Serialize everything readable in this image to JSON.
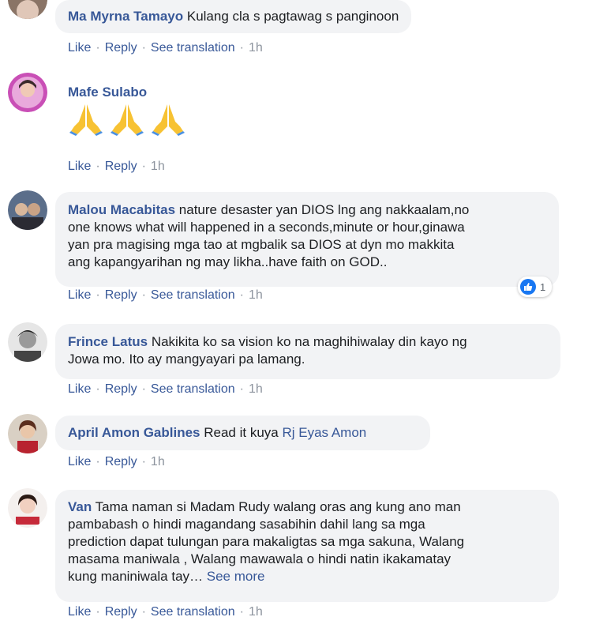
{
  "comments": [
    {
      "author": "Ma Myrna Tamayo",
      "text": "Kulang cla s pagtawag s panginoon",
      "actions": [
        "Like",
        "Reply",
        "See translation"
      ],
      "time": "1h"
    },
    {
      "author": "Mafe Sulabo",
      "emojis": [
        "folded-hands",
        "folded-hands",
        "folded-hands"
      ],
      "actions": [
        "Like",
        "Reply"
      ],
      "time": "1h"
    },
    {
      "author": "Malou Macabitas",
      "text_lines": [
        "nature desaster yan DIOS lng ang nakkaalam,no",
        "one knows what will happened in a seconds,minute or hour,ginawa",
        "yan pra magising mga tao at mgbalik sa DIOS at dyn mo makkita",
        "ang kapangyarihan ng may likha..have faith on GOD.."
      ],
      "reaction_count": "1",
      "actions": [
        "Like",
        "Reply",
        "See translation"
      ],
      "time": "1h"
    },
    {
      "author": "Frince Latus",
      "text_lines": [
        "Nakikita ko sa vision ko na maghihiwalay din kayo ng",
        "Jowa mo. Ito ay mangyayari pa lamang."
      ],
      "actions": [
        "Like",
        "Reply",
        "See translation"
      ],
      "time": "1h"
    },
    {
      "author": "April Amon Gablines",
      "text": "Read it kuya",
      "mention": "Rj Eyas Amon",
      "actions": [
        "Like",
        "Reply"
      ],
      "time": "1h"
    },
    {
      "author": "Van",
      "text_lines": [
        "Tama naman si Madam Rudy walang oras ang kung ano man",
        "pambabash o hindi magandang sasabihin dahil lang sa mga",
        "prediction dapat tulungan para makaligtas sa mga sakuna, Walang",
        "masama maniwala , Walang mawawala o hindi natin ikakamatay",
        "kung maniniwala tay…"
      ],
      "see_more": "See more",
      "actions": [
        "Like",
        "Reply",
        "See translation"
      ],
      "time": "1h"
    }
  ],
  "colors": {
    "link": "#385898",
    "bubble": "#f2f3f5",
    "meta": "#8d949e",
    "like_blue": "#1877f2"
  }
}
